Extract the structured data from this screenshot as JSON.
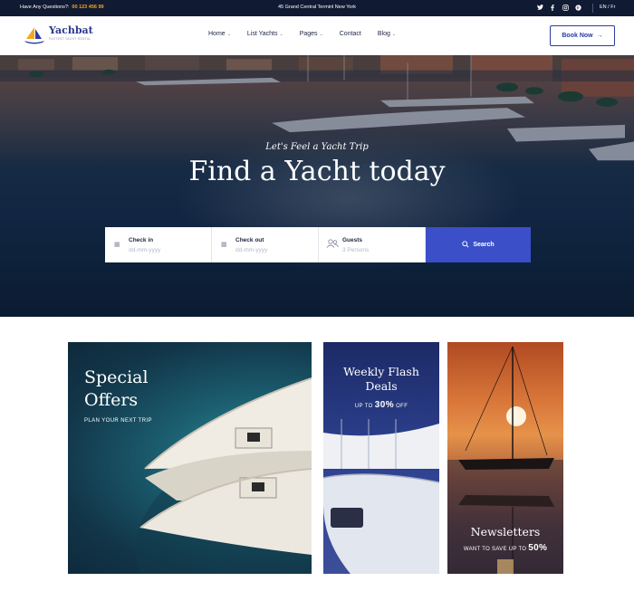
{
  "topbar": {
    "questions_label": "Have Any Questions?:",
    "phone": "00 123 456 99",
    "address": "45 Grand Central Terminl New York",
    "socials": [
      "twitter-icon",
      "facebook-icon",
      "instagram-icon",
      "pinterest-icon"
    ],
    "lang": "EN / Fr"
  },
  "header": {
    "logo_name": "Yachbat",
    "logo_tagline": "FASTEST YACHT RENTAL",
    "nav": [
      {
        "label": "Home",
        "has_dropdown": true
      },
      {
        "label": "List Yachts",
        "has_dropdown": true
      },
      {
        "label": "Pages",
        "has_dropdown": true
      },
      {
        "label": "Contact",
        "has_dropdown": false
      },
      {
        "label": "Blog",
        "has_dropdown": true
      }
    ],
    "cta_label": "Book Now"
  },
  "hero": {
    "script_text": "Let's Feel a Yacht Trip",
    "title": "Find a Yacht today"
  },
  "search": {
    "checkin_label": "Check in",
    "checkin_placeholder": "dd-mm-yyyy",
    "checkout_label": "Check out",
    "checkout_placeholder": "dd-mm-yyyy",
    "guests_label": "Guests",
    "guests_value": "3  Persons",
    "button_label": "Search"
  },
  "cards": {
    "special": {
      "title_line1": "Special",
      "title_line2": "Offers",
      "subtitle": "PLAN YOUR NEXT TRIP"
    },
    "flash": {
      "title_line1": "Weekly Flash",
      "title_line2": "Deals",
      "subtitle_pre": "UP TO ",
      "subtitle_value": "30%",
      "subtitle_post": " OFF"
    },
    "newsletter": {
      "title": "Newsletters",
      "subtitle_pre": "WANT TO SAVE UP TO ",
      "subtitle_value": "50%"
    }
  },
  "colors": {
    "topbar_bg": "#111a33",
    "accent_orange": "#f5a623",
    "brand_blue": "#2b3aa5",
    "search_button": "#3a4fc8"
  }
}
